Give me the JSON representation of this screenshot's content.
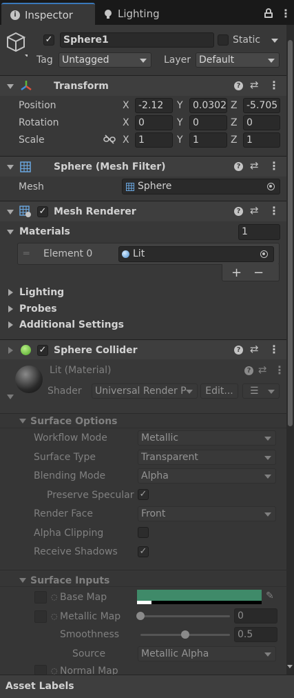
{
  "tabs": [
    {
      "label": "Inspector",
      "icon": "info-icon",
      "active": true
    },
    {
      "label": "Lighting",
      "icon": "lightbulb-icon",
      "active": false
    }
  ],
  "object": {
    "name": "Sphere1",
    "static_label": "Static",
    "tag_label": "Tag",
    "tag_value": "Untagged",
    "layer_label": "Layer",
    "layer_value": "Default",
    "active": true,
    "static": false
  },
  "transform": {
    "title": "Transform",
    "position_label": "Position",
    "rotation_label": "Rotation",
    "scale_label": "Scale",
    "x": "X",
    "y": "Y",
    "z": "Z",
    "position": {
      "x": "-2.12",
      "y": "0.0302",
      "z": "-5.705"
    },
    "rotation": {
      "x": "0",
      "y": "0",
      "z": "0"
    },
    "scale": {
      "x": "1",
      "y": "1",
      "z": "1"
    }
  },
  "mesh_filter": {
    "title": "Sphere (Mesh Filter)",
    "mesh_label": "Mesh",
    "mesh_value": "Sphere"
  },
  "mesh_renderer": {
    "title": "Mesh Renderer",
    "enabled": true,
    "materials_label": "Materials",
    "materials_count": "1",
    "element_label": "Element 0",
    "element_value": "Lit",
    "add_glyph": "+",
    "remove_glyph": "−",
    "lighting_label": "Lighting",
    "probes_label": "Probes",
    "additional_label": "Additional Settings"
  },
  "sphere_collider": {
    "title": "Sphere Collider",
    "enabled": true
  },
  "material": {
    "title": "Lit (Material)",
    "shader_label": "Shader",
    "shader_value": "Universal Render P",
    "edit_label": "Edit...",
    "surface_options": {
      "title": "Surface Options",
      "workflow_label": "Workflow Mode",
      "workflow_value": "Metallic",
      "surface_type_label": "Surface Type",
      "surface_type_value": "Transparent",
      "blending_label": "Blending Mode",
      "blending_value": "Alpha",
      "preserve_label": "Preserve Specular",
      "preserve_checked": true,
      "render_face_label": "Render Face",
      "render_face_value": "Front",
      "alpha_clip_label": "Alpha Clipping",
      "alpha_clip_checked": false,
      "receive_shadows_label": "Receive Shadows",
      "receive_shadows_checked": true
    },
    "surface_inputs": {
      "title": "Surface Inputs",
      "base_map_label": "Base Map",
      "base_color": "#3f8a69",
      "metallic_label": "Metallic Map",
      "metallic_value": "0",
      "metallic_level": 0,
      "smoothness_label": "Smoothness",
      "smoothness_value": "0.5",
      "smoothness_level": 0.5,
      "source_label": "Source",
      "source_value": "Metallic Alpha",
      "normal_label": "Normal Map"
    }
  },
  "footer": {
    "asset_labels": "Asset Labels"
  },
  "colors": {
    "header_bg": "#3e3e3e",
    "panel_bg": "#383838",
    "accent": "#3f8a69"
  }
}
